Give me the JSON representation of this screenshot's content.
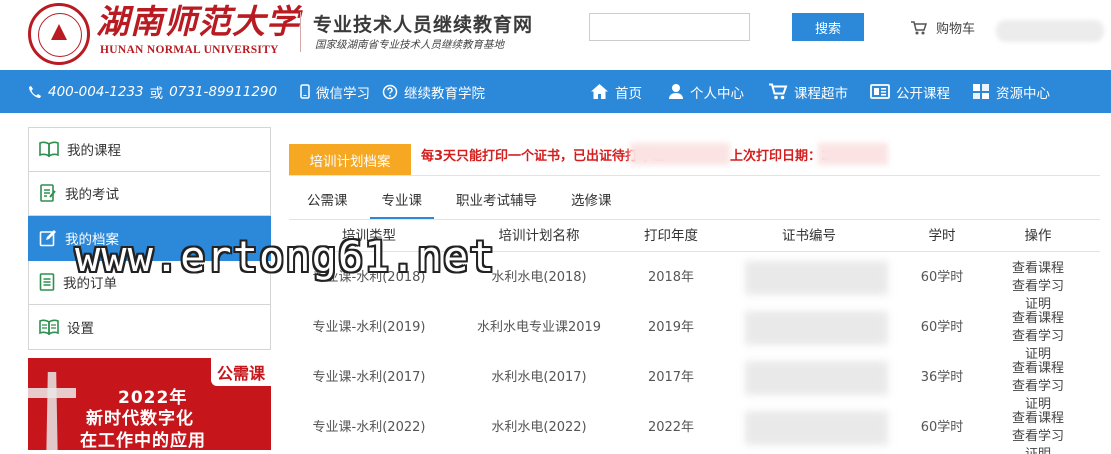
{
  "header": {
    "university_cn": "湖南师范大学",
    "university_en": "HUNAN NORMAL UNIVERSITY",
    "site_title": "专业技术人员继续教育网",
    "site_subtitle": "国家级湖南省专业技术人员继续教育基地",
    "search_placeholder": "",
    "search_button": "搜索",
    "cart_label": "购物车"
  },
  "nav": {
    "phone1": "400-004-1233",
    "or": "或",
    "phone2": "0731-89911290",
    "wechat": "微信学习",
    "college": "继续教育学院",
    "items": [
      {
        "label": "首页",
        "icon": "home-icon"
      },
      {
        "label": "个人中心",
        "icon": "user-icon"
      },
      {
        "label": "课程超市",
        "icon": "cart-icon"
      },
      {
        "label": "公开课程",
        "icon": "open-course-icon"
      },
      {
        "label": "资源中心",
        "icon": "resource-icon"
      }
    ]
  },
  "sidebar": {
    "items": [
      {
        "label": "我的课程",
        "active": false
      },
      {
        "label": "我的考试",
        "active": false
      },
      {
        "label": "我的档案",
        "active": true
      },
      {
        "label": "我的订单",
        "active": false
      },
      {
        "label": "设置",
        "active": false
      }
    ]
  },
  "banner": {
    "tag": "公需课",
    "line1": "2022年",
    "line2": "新时代数字化",
    "line3": "在工作中的应用"
  },
  "main": {
    "section_tab": "培训计划档案",
    "notice": "每3天只能打印一个证书，已出证待打印证",
    "notice2": "上次打印日期：2",
    "subtabs": [
      {
        "label": "公需课",
        "active": false
      },
      {
        "label": "专业课",
        "active": true
      },
      {
        "label": "职业考试辅导",
        "active": false
      },
      {
        "label": "选修课",
        "active": false
      }
    ],
    "table": {
      "headers": [
        "培训类型",
        "培训计划名称",
        "打印年度",
        "证书编号",
        "学时",
        "操作"
      ],
      "rows": [
        {
          "type": "专业课-水利(2018)",
          "name": "水利水电(2018)",
          "year": "2018年",
          "cert": "10",
          "hours": "60学时"
        },
        {
          "type": "专业课-水利(2019)",
          "name": "水利水电专业课2019",
          "year": "2019年",
          "cert": "10",
          "hours": "60学时"
        },
        {
          "type": "专业课-水利(2017)",
          "name": "水利水电(2017)",
          "year": "2017年",
          "cert": "1",
          "hours": "36学时"
        },
        {
          "type": "专业课-水利(2022)",
          "name": "水利水电(2022)",
          "year": "2022年",
          "cert": "10",
          "hours": "60学时"
        }
      ],
      "op_view_course": "查看课程",
      "op_view_cert": "查看学习证明"
    }
  },
  "watermark": "www.ertong61.net",
  "colors": {
    "brand_red": "#b81c22",
    "nav_blue": "#2c88d9",
    "tab_orange": "#f6a823",
    "notice_red": "#d41d1d"
  }
}
